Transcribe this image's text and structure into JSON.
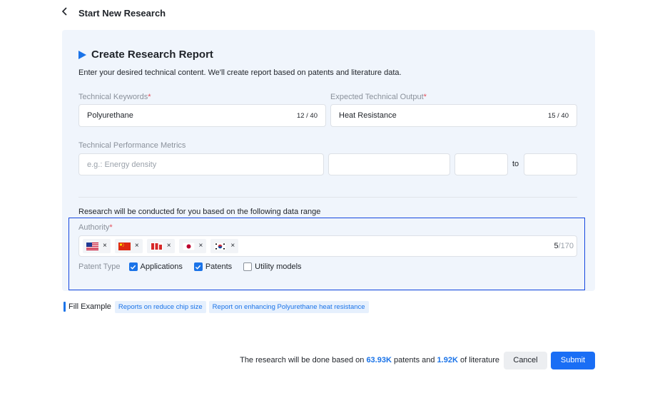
{
  "header": {
    "back_icon": "chevron-left-icon",
    "title": "Start New Research"
  },
  "form": {
    "heading": "Create Research Report",
    "subtitle": "Enter your desired technical content. We'll create report based on patents and literature data.",
    "keywords": {
      "label": "Technical Keywords",
      "required_mark": "*",
      "value": "Polyurethane",
      "count": "12 / 40"
    },
    "output": {
      "label": "Expected Technical Output",
      "required_mark": "*",
      "value": "Heat Resistance",
      "count": "15 / 40"
    },
    "metrics": {
      "label": "Technical Performance Metrics",
      "placeholder": "e.g.: Energy density",
      "to_label": "to"
    },
    "range_text": "Research will be conducted for you based on the following data range",
    "authority": {
      "label": "Authority",
      "required_mark": "*",
      "chips": [
        {
          "flag": "us-flag-icon",
          "remove": "×"
        },
        {
          "flag": "cn-flag-icon",
          "remove": "×"
        },
        {
          "flag": "ep-flag-icon",
          "remove": "×"
        },
        {
          "flag": "jp-flag-icon",
          "remove": "×"
        },
        {
          "flag": "kr-flag-icon",
          "remove": "×"
        }
      ],
      "count_current": "5",
      "count_max": "/170"
    },
    "patent_type": {
      "label": "Patent Type",
      "options": [
        {
          "label": "Applications",
          "checked": true
        },
        {
          "label": "Patents",
          "checked": true
        },
        {
          "label": "Utility models",
          "checked": false
        }
      ]
    }
  },
  "fill_example": {
    "label": "Fill Example",
    "tags": [
      "Reports on reduce chip size",
      "Report on enhancing Polyurethane heat resistance"
    ]
  },
  "footer": {
    "text_prefix": "The research will be done based on",
    "patents_count": "63.93K",
    "text_middle": "patents and",
    "literature_count": "1.92K",
    "text_suffix": "of literature",
    "cancel_label": "Cancel",
    "submit_label": "Submit"
  },
  "colors": {
    "accent": "#1a73e8",
    "card_bg": "#f0f5fc",
    "highlight_border": "#1547e0",
    "required": "#e34d59"
  }
}
